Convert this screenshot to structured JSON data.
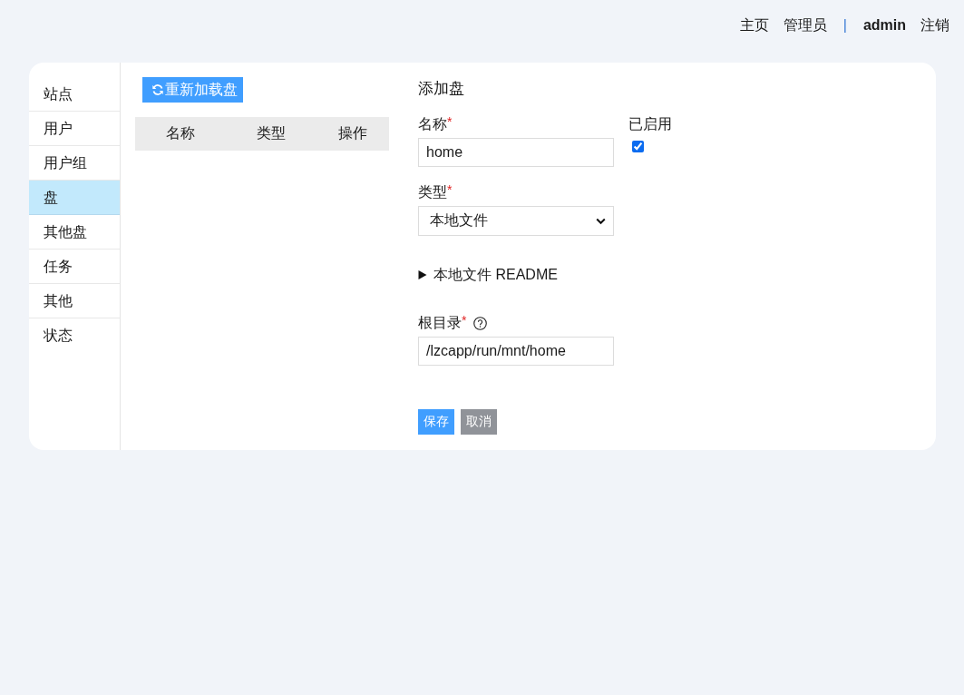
{
  "top_nav": {
    "links": [
      {
        "label": "主页"
      },
      {
        "label": "管理员"
      }
    ],
    "separator": "|",
    "user": "admin",
    "logout": "注销"
  },
  "sidebar": {
    "items": [
      {
        "label": "站点",
        "selected": false
      },
      {
        "label": "用户",
        "selected": false
      },
      {
        "label": "用户组",
        "selected": false
      },
      {
        "label": "盘",
        "selected": true
      },
      {
        "label": "其他盘",
        "selected": false
      },
      {
        "label": "任务",
        "selected": false
      },
      {
        "label": "其他",
        "selected": false
      },
      {
        "label": "状态",
        "selected": false
      }
    ]
  },
  "disk_list": {
    "reload_button": "重新加载盘",
    "table": {
      "columns": [
        "名称",
        "类型",
        "操作"
      ]
    }
  },
  "form": {
    "title": "添加盘",
    "name_field": {
      "label": "名称",
      "mark": "*",
      "value": "home"
    },
    "enabled_field": {
      "label": "已启用",
      "checked": true
    },
    "type_field": {
      "label": "类型",
      "mark": "*",
      "value": "本地文件"
    },
    "readme": {
      "label": "本地文件 README",
      "expanded": false
    },
    "root_field": {
      "label": "根目录",
      "mark": "*",
      "value": "/lzcapp/run/mnt/home"
    },
    "buttons": [
      {
        "label": "保存",
        "kind": "primary"
      },
      {
        "label": "取消",
        "kind": "secondary"
      }
    ]
  }
}
